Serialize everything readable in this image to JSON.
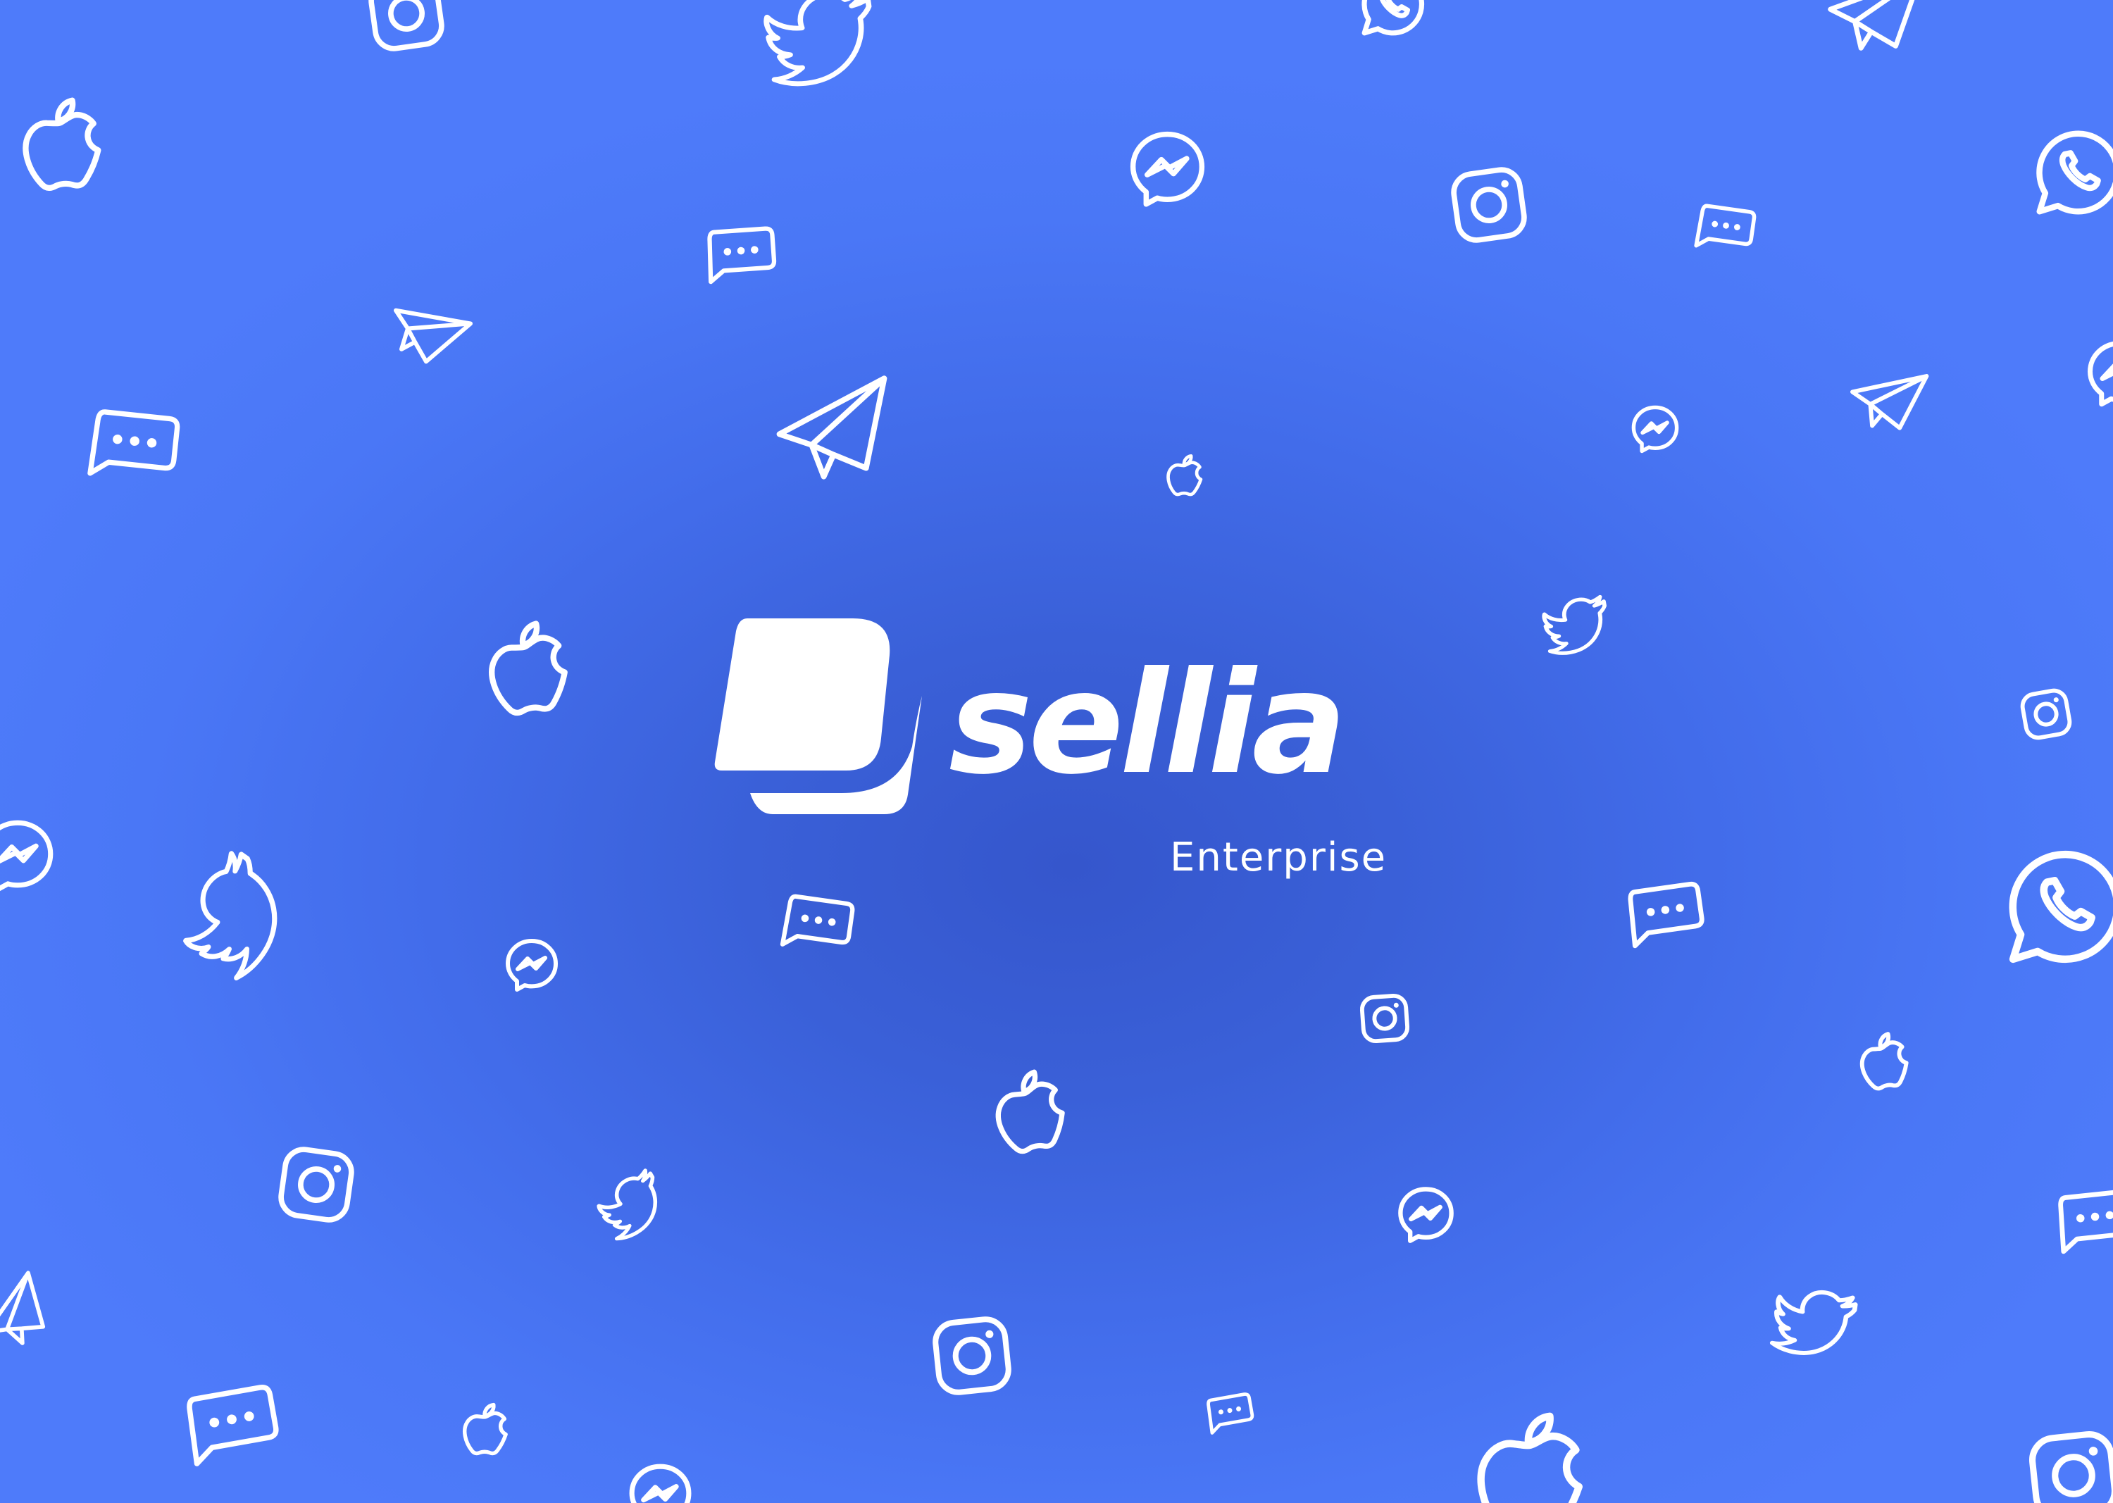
{
  "brand": {
    "name": "sellia",
    "subtitle": "Enterprise"
  },
  "colors": {
    "background": "#4a77f6",
    "background_center": "#3556cc",
    "foreground": "#ffffff"
  },
  "background_icons": [
    "instagram-icon",
    "twitter-icon",
    "whatsapp-icon",
    "telegram-icon",
    "apple-icon",
    "messenger-icon",
    "chat-bubble-icon"
  ]
}
